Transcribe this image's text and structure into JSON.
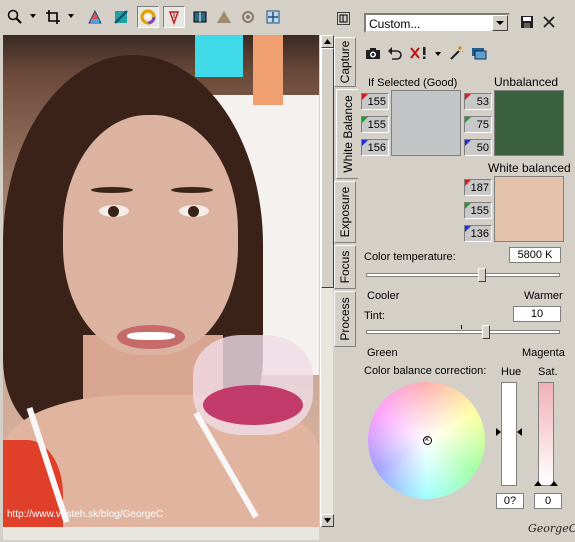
{
  "panel": {
    "preset_value": "Custom...",
    "if_selected_label": "If Selected (Good)",
    "unbalanced_label": "Unbalanced",
    "white_balanced_label": "White balanced",
    "if_selected_rgb": [
      "155",
      "155",
      "156"
    ],
    "unbalanced_rgb": [
      "53",
      "75",
      "50"
    ],
    "white_balanced_rgb": [
      "187",
      "155",
      "136"
    ],
    "colors": {
      "if_selected": "#c3c6c6",
      "unbalanced": "#3a5f3c",
      "white_balanced": "#e3c2ac"
    },
    "color_temperature_label": "Color temperature:",
    "color_temperature_value": "5800 K",
    "cooler_label": "Cooler",
    "warmer_label": "Warmer",
    "tint_label": "Tint:",
    "tint_value": "10",
    "green_label": "Green",
    "magenta_label": "Magenta",
    "color_balance_label": "Color balance correction:",
    "hue_label": "Hue",
    "sat_label": "Sat.",
    "hue_value": "0?",
    "sat_value": "0",
    "temperature_level": 0.6,
    "tint_level": 0.62
  },
  "tabs": [
    "Capture",
    "White Balance",
    "Exposure",
    "Focus",
    "Process"
  ],
  "active_tab": "White Balance",
  "toolbar": {
    "icons": [
      "zoom-icon",
      "crop-icon",
      "levels-icon",
      "curves-icon",
      "color-wheel-icon",
      "eyedropper-icon",
      "compare-icon",
      "triangle-icon",
      "rotate-icon",
      "fit-icon"
    ]
  },
  "image": {
    "watermark_text": "http://www.vasteh.sk/blog/GeorgeC",
    "signature": "GeorgeC"
  }
}
